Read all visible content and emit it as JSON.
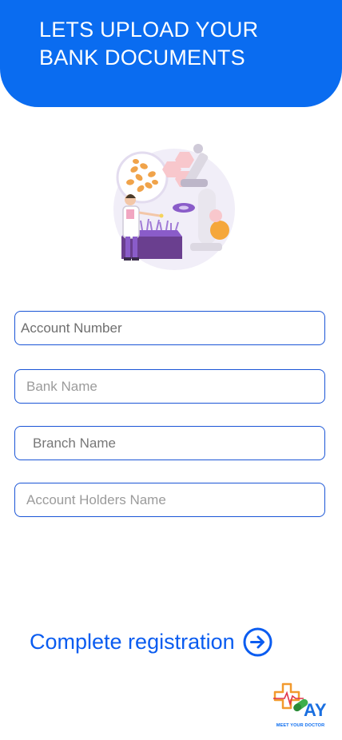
{
  "header": {
    "title": "LETS UPLOAD YOUR BANK DOCUMENTS"
  },
  "form": {
    "account_number": {
      "value": "",
      "placeholder": "Account Number"
    },
    "bank_name": {
      "value": "",
      "placeholder": "Bank Name"
    },
    "branch_name": {
      "value": "",
      "placeholder": "Branch Name"
    },
    "account_holders_name": {
      "value": "",
      "placeholder": "Account Holders Name"
    }
  },
  "actions": {
    "complete_label": "Complete registration",
    "complete_icon": "arrow-right-circle-icon"
  },
  "logo": {
    "mark": "AY",
    "caption": "MEET YOUR DOCTOR"
  },
  "colors": {
    "primary": "#0a6cf0",
    "field_border": "#1a55d6",
    "link": "#0a5cf0",
    "illustration_purple": "#8a5cc9",
    "illustration_orange": "#f5a73b",
    "illustration_pink": "#f8c7cc"
  }
}
